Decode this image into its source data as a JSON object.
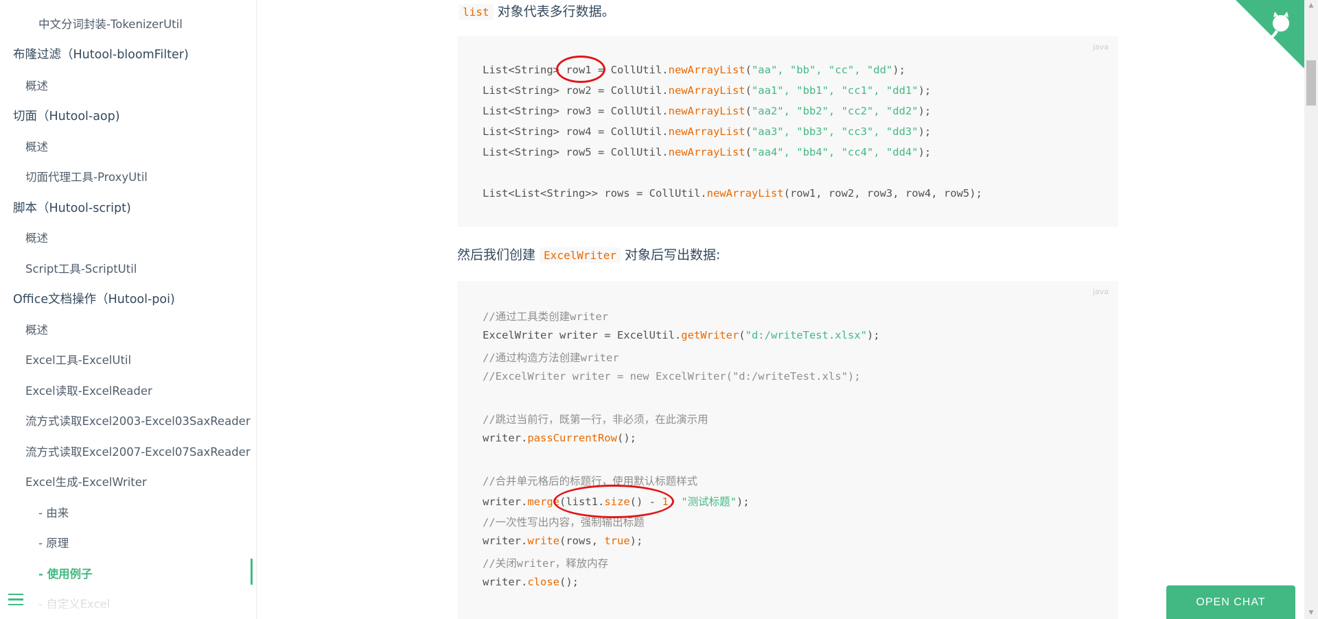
{
  "sidebar": {
    "items": [
      {
        "label": "中文分词封装-TokenizerUtil",
        "level": 3
      },
      {
        "label": "布隆过滤（Hutool-bloomFilter)",
        "level": 1
      },
      {
        "label": "概述",
        "level": 2
      },
      {
        "label": "切面（Hutool-aop)",
        "level": 1
      },
      {
        "label": "概述",
        "level": 2
      },
      {
        "label": "切面代理工具-ProxyUtil",
        "level": 2
      },
      {
        "label": "脚本（Hutool-script)",
        "level": 1
      },
      {
        "label": "概述",
        "level": 2
      },
      {
        "label": "Script工具-ScriptUtil",
        "level": 2
      },
      {
        "label": "Office文档操作（Hutool-poi)",
        "level": 1
      },
      {
        "label": "概述",
        "level": 2
      },
      {
        "label": "Excel工具-ExcelUtil",
        "level": 2
      },
      {
        "label": "Excel读取-ExcelReader",
        "level": 2
      },
      {
        "label": "流方式读取Excel2003-Excel03SaxReader",
        "level": 2
      },
      {
        "label": "流方式读取Excel2007-Excel07SaxReader",
        "level": 2
      },
      {
        "label": "Excel生成-ExcelWriter",
        "level": 2
      },
      {
        "label": "- 由来",
        "level": 3
      },
      {
        "label": "- 原理",
        "level": 3
      },
      {
        "label": "- 使用例子",
        "level": 3,
        "active": true
      },
      {
        "label": "- 自定义Excel",
        "level": 3
      }
    ],
    "menu_icon": "hamburger-icon",
    "accent": "#42b983"
  },
  "content": {
    "para1": {
      "code": "list",
      "text": " 对象代表多行数据。"
    },
    "block1": {
      "lang": "java",
      "lines": [
        {
          "t": "List<String> row1 = CollUtil.",
          "fn": "newArrayList",
          "a": "(",
          "s": "\"aa\", \"bb\", \"cc\", \"dd\"",
          "b": ");"
        },
        {
          "t": "List<String> row2 = CollUtil.",
          "fn": "newArrayList",
          "a": "(",
          "s": "\"aa1\", \"bb1\", \"cc1\", \"dd1\"",
          "b": ");"
        },
        {
          "t": "List<String> row3 = CollUtil.",
          "fn": "newArrayList",
          "a": "(",
          "s": "\"aa2\", \"bb2\", \"cc2\", \"dd2\"",
          "b": ");"
        },
        {
          "t": "List<String> row4 = CollUtil.",
          "fn": "newArrayList",
          "a": "(",
          "s": "\"aa3\", \"bb3\", \"cc3\", \"dd3\"",
          "b": ");"
        },
        {
          "t": "List<String> row5 = CollUtil.",
          "fn": "newArrayList",
          "a": "(",
          "s": "\"aa4\", \"bb4\", \"cc4\", \"dd4\"",
          "b": ");"
        },
        {
          "t": "List<List<String>> rows = CollUtil.",
          "fn": "newArrayList",
          "a": "(row1, row2, row3, row4, row5);",
          "s": "",
          "b": ""
        }
      ]
    },
    "para2": {
      "pre": "然后我们创建 ",
      "code": "ExcelWriter",
      "post": " 对象后写出数据:"
    },
    "block2": {
      "lang": "java",
      "comment1": "//通过工具类创建writer",
      "line2_a": "ExcelWriter writer = ExcelUtil.",
      "line2_fn": "getWriter",
      "line2_b": "(",
      "line2_s": "\"d:/writeTest.xlsx\"",
      "line2_c": ");",
      "comment3": "//通过构造方法创建writer",
      "comment4": "//ExcelWriter writer = new ExcelWriter(\"d:/writeTest.xls\");",
      "comment5": "//跳过当前行，既第一行，非必须，在此演示用",
      "line6_a": "writer.",
      "line6_fn": "passCurrentRow",
      "line6_b": "();",
      "comment7": "//合并单元格后的标题行，使用默认标题样式",
      "line8_a": "writer.",
      "line8_fn": "merge",
      "line8_b": "(list1.",
      "line8_fn2": "size",
      "line8_c": "() - ",
      "line8_num": "1",
      "line8_d": ", ",
      "line8_s": "\"测试标题\"",
      "line8_e": ");",
      "comment9": "//一次性写出内容，强制输出标题",
      "line10_a": "writer.",
      "line10_fn": "write",
      "line10_b": "(rows, ",
      "line10_kw": "true",
      "line10_c": ");",
      "comment11": "//关闭writer，释放内存",
      "line12_a": "writer.",
      "line12_fn": "close",
      "line12_b": "();"
    }
  },
  "open_chat": {
    "label": "OPEN CHAT"
  },
  "corner_icon": "github-octocat-icon",
  "annotation_color": "#e0161a"
}
